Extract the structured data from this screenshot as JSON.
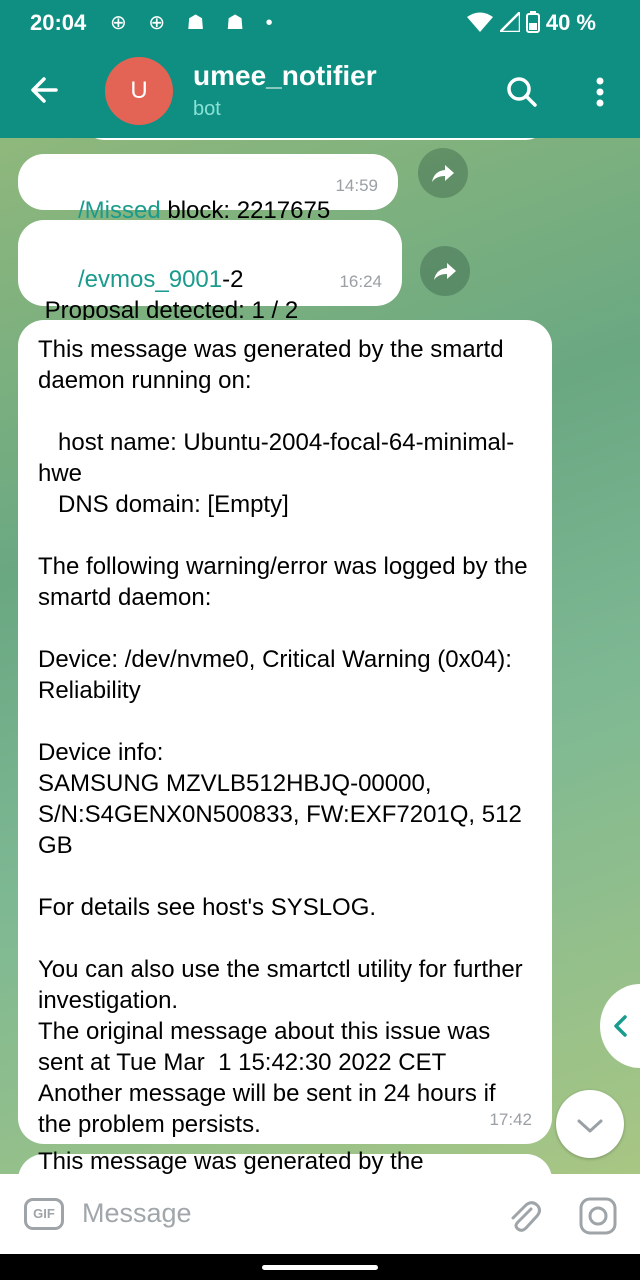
{
  "status_bar": {
    "time": "20:04",
    "notification_icons": "⊕ ⊕ ☗ ☗ •",
    "battery": "40 %"
  },
  "header": {
    "avatar_letter": "U",
    "title": "umee_notifier",
    "subtitle": "bot",
    "avatar_color": "#e36455",
    "accent": "#0f8f82"
  },
  "messages": [
    {
      "link": "/Missed",
      "text": " block: 2217675",
      "time": "14:59"
    },
    {
      "link": "/evmos_9001",
      "text": "-2\n Proposal detected: 1 / 2",
      "time": "16:24"
    },
    {
      "text": "This message was generated by the smartd daemon running on:\n\n   host name: Ubuntu-2004-focal-64-minimal-hwe\n   DNS domain: [Empty]\n\nThe following warning/error was logged by the smartd daemon:\n\nDevice: /dev/nvme0, Critical Warning (0x04): Reliability\n\nDevice info:\nSAMSUNG MZVLB512HBJQ-00000, S/N:S4GENX0N500833, FW:EXF7201Q, 512 GB\n\nFor details see host's SYSLOG.\n\nYou can also use the smartctl utility for further investigation.\nThe original message about this issue was sent at Tue Mar  1 15:42:30 2022 CET\nAnother message will be sent in 24 hours if the problem persists.",
      "time": "17:42"
    },
    {
      "text": "This message was generated by the"
    }
  ],
  "input": {
    "placeholder": "Message",
    "gif_label": "GIF"
  }
}
